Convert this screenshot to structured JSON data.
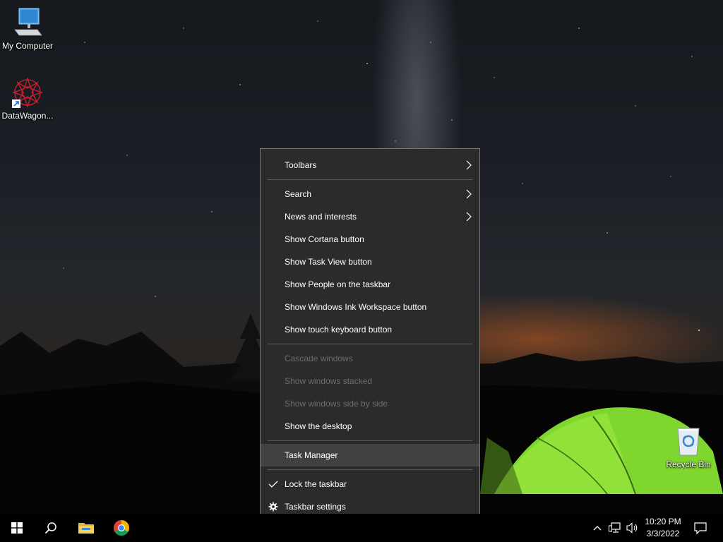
{
  "desktop": {
    "icons": [
      {
        "label": "My Computer"
      },
      {
        "label": "DataWagon..."
      },
      {
        "label": "Recycle Bin"
      }
    ]
  },
  "context_menu": {
    "toolbars": "Toolbars",
    "search": "Search",
    "news": "News and interests",
    "cortana": "Show Cortana button",
    "task_view": "Show Task View button",
    "people": "Show People on the taskbar",
    "ink": "Show Windows Ink Workspace button",
    "touch_keyboard": "Show touch keyboard button",
    "cascade": "Cascade windows",
    "stacked": "Show windows stacked",
    "side_by_side": "Show windows side by side",
    "show_desktop": "Show the desktop",
    "task_manager": "Task Manager",
    "lock": "Lock the taskbar",
    "settings": "Taskbar settings"
  },
  "taskbar": {
    "time": "10:20 PM",
    "date": "3/3/2022"
  },
  "colors": {
    "menu_bg": "#2b2b2b",
    "menu_highlight": "#414141",
    "disabled_text": "#6d6d6d",
    "taskbar_bg": "#000000"
  }
}
